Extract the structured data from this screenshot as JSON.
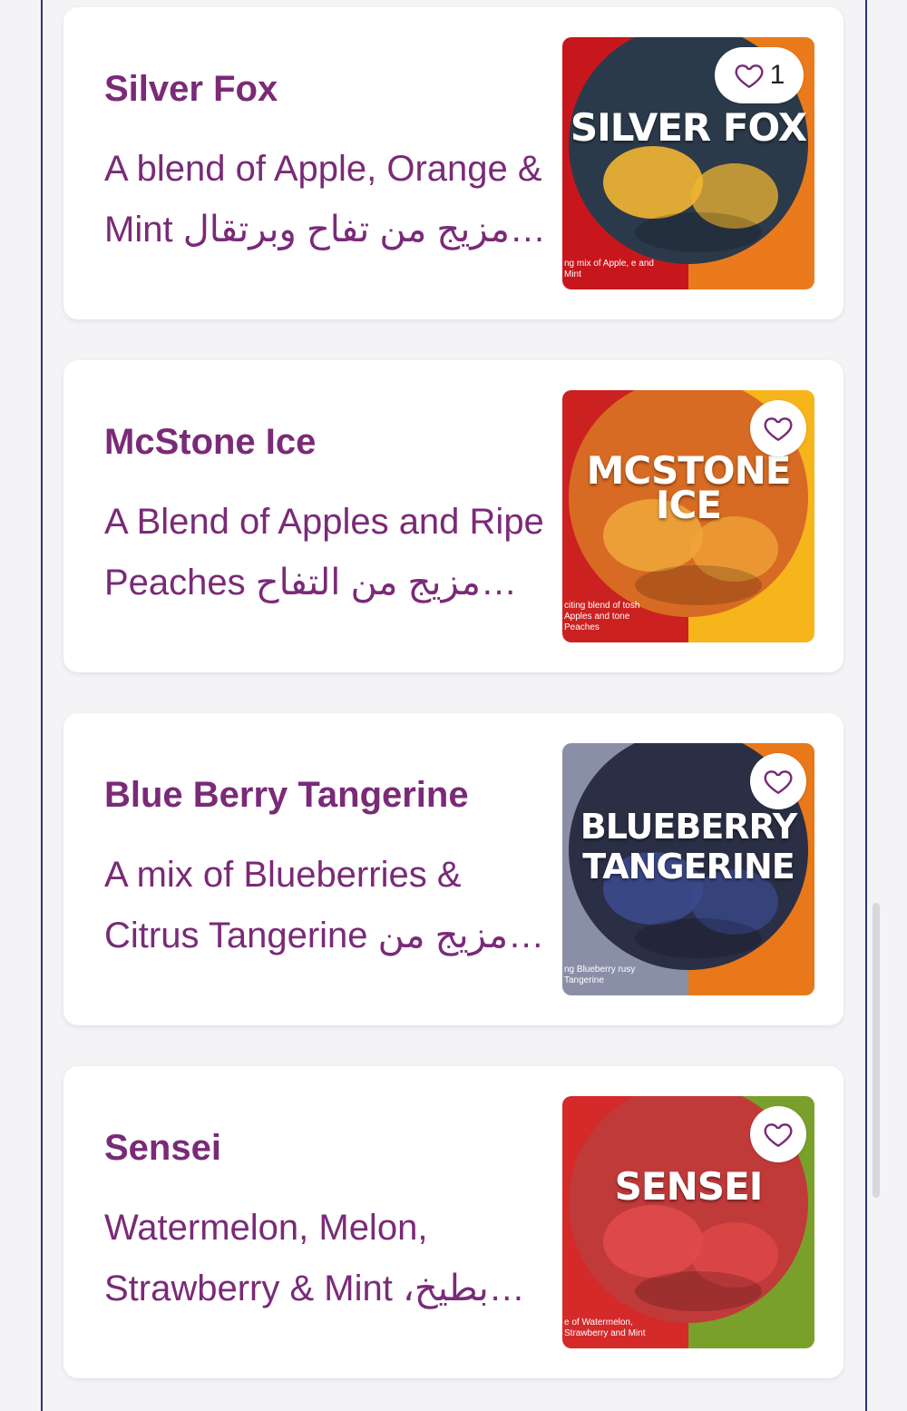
{
  "products": [
    {
      "name": "Silver Fox",
      "description": "A blend of Apple, Orange & Mint مزيج من تفاح وبرتقال ونعناع",
      "image_text": "SILVER FOX",
      "image_caption": "ng mix of Apple, e and Mint",
      "like_count": "1",
      "colors": {
        "left": "#c8161d",
        "right": "#ea7a1c",
        "circle": "#2b3a4a",
        "fruit": "#f2b632"
      }
    },
    {
      "name": "McStone Ice",
      "description": "A Blend of Apples and Ripe Peaches مزيج من التفاح والخوخ",
      "image_text": "MCSTONE ICE",
      "image_caption": "citing blend of tosh Apples and tone Peaches",
      "like_count": "",
      "colors": {
        "left": "#cc2121",
        "right": "#f7b51c",
        "circle": "#d86b23",
        "fruit": "#f0a53a"
      }
    },
    {
      "name": "Blue Berry Tangerine",
      "description": "A mix of Blueberries & Citrus Tangerine مزيج من التوت الأزرق",
      "image_text": "BLUEBERRY TANGERINE",
      "image_caption": "ng Blueberry rusy Tangerine",
      "like_count": "",
      "colors": {
        "left": "#8a8fa8",
        "right": "#e8781a",
        "circle": "#2a2f45",
        "fruit": "#3b4a8c"
      }
    },
    {
      "name": "Sensei",
      "description": "Watermelon, Melon, Strawberry & Mint بطيخ، شمام",
      "image_text": "SENSEI",
      "image_caption": "e of Watermelon, Strawberry and Mint",
      "like_count": "",
      "colors": {
        "left": "#d42a2a",
        "right": "#7aa02c",
        "circle": "#c13a3a",
        "fruit": "#e04a4a"
      }
    }
  ]
}
